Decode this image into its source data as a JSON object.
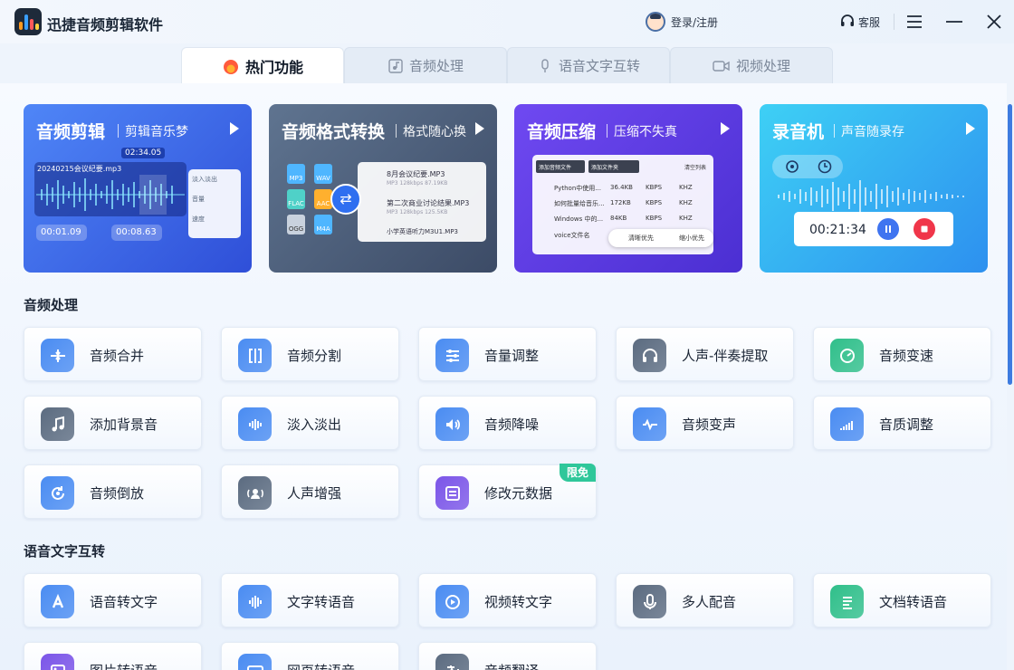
{
  "app": {
    "title": "迅捷音频剪辑软件",
    "login": "登录/注册",
    "service": "客服"
  },
  "tabs": [
    {
      "label": "热门功能",
      "active": true
    },
    {
      "label": "音频处理",
      "active": false
    },
    {
      "label": "语音文字互转",
      "active": false
    },
    {
      "label": "视频处理",
      "active": false
    }
  ],
  "banners": [
    {
      "title": "音频剪辑",
      "subtitle": "剪辑音乐梦",
      "time": "02:34.05",
      "file": "20240215会议纪要.mp3",
      "start": "00:01.09",
      "end": "00:08.63",
      "opts": [
        "淡入淡出",
        "音量",
        "速度"
      ]
    },
    {
      "title": "音频格式转换",
      "subtitle": "格式随心换",
      "formats": [
        "MP3",
        "WAV",
        "FLAC",
        "AAC",
        "OGG",
        "M4A"
      ],
      "files": [
        {
          "name": "8月会议纪要.MP3",
          "meta": "MP3   128kbps   87.19KB"
        },
        {
          "name": "第二次商业讨论结果.MP3",
          "meta": "MP3   128kbps   125.5KB"
        },
        {
          "name": "小学英语听力M3U1.MP3",
          "meta": ""
        }
      ]
    },
    {
      "title": "音频压缩",
      "subtitle": "压缩不失真",
      "add_file": "添加音频文件",
      "add_folder": "添加文件夹",
      "clear": "清空列表",
      "rows": [
        [
          "Python中使用...",
          "36.4KB",
          "KBPS",
          "KHZ"
        ],
        [
          "如何批量给音乐...",
          "172KB",
          "KBPS",
          "KHZ"
        ],
        [
          "Windows 中的...",
          "84KB",
          "KBPS",
          "KHZ"
        ],
        [
          "voice文件名",
          "",
          "",
          ""
        ]
      ],
      "opt1": "清晰优先",
      "opt2": "缩小优先"
    },
    {
      "title": "录音机",
      "subtitle": "声音随录存",
      "time": "00:21:34"
    }
  ],
  "sections": [
    {
      "title": "音频处理",
      "items": [
        {
          "label": "音频合并",
          "icon": "merge-icon",
          "color": "#4a8cf2"
        },
        {
          "label": "音频分割",
          "icon": "split-icon",
          "color": "#4a8cf2"
        },
        {
          "label": "音量调整",
          "icon": "sliders-icon",
          "color": "#4a8cf2"
        },
        {
          "label": "人声-伴奏提取",
          "icon": "headphone-icon",
          "color": "#5b6b80"
        },
        {
          "label": "音频变速",
          "icon": "speed-icon",
          "color": "#2fbf8a"
        },
        {
          "label": "添加背景音",
          "icon": "music-note-icon",
          "color": "#5b6b80"
        },
        {
          "label": "淡入淡出",
          "icon": "bars-icon",
          "color": "#4a8cf2"
        },
        {
          "label": "音频降噪",
          "icon": "speaker-icon",
          "color": "#4a8cf2"
        },
        {
          "label": "音频变声",
          "icon": "voice-change-icon",
          "color": "#4a8cf2"
        },
        {
          "label": "音质调整",
          "icon": "quality-icon",
          "color": "#4a8cf2"
        },
        {
          "label": "音频倒放",
          "icon": "reverse-icon",
          "color": "#4a8cf2"
        },
        {
          "label": "人声增强",
          "icon": "voice-enhance-icon",
          "color": "#5b6b80"
        },
        {
          "label": "修改元数据",
          "icon": "metadata-icon",
          "color": "#7b55e8",
          "badge": "限免"
        }
      ]
    },
    {
      "title": "语音文字互转",
      "items": [
        {
          "label": "语音转文字",
          "icon": "letter-a-icon",
          "color": "#4a8cf2"
        },
        {
          "label": "文字转语音",
          "icon": "waveform-icon",
          "color": "#4a8cf2"
        },
        {
          "label": "视频转文字",
          "icon": "play-icon",
          "color": "#4a8cf2"
        },
        {
          "label": "多人配音",
          "icon": "microphone-icon",
          "color": "#5b6b80"
        },
        {
          "label": "文档转语音",
          "icon": "document-icon",
          "color": "#2fbf8a"
        },
        {
          "label": "图片转语音",
          "icon": "image-icon",
          "color": "#7b55e8"
        },
        {
          "label": "网页转语音",
          "icon": "web-icon",
          "color": "#4a8cf2"
        },
        {
          "label": "音频翻译",
          "icon": "translate-icon",
          "color": "#5b6b80"
        }
      ]
    }
  ]
}
